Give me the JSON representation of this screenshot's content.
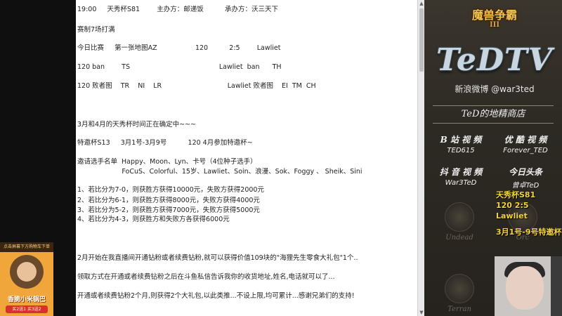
{
  "document": {
    "lines": [
      "19:00     天秀杯S81        主办方：邮递饭          承办方：沃三天下",
      "赛制7场打满",
      "今日比赛     第一张地图AZ                  120          2:5        Lawliet",
      "120 ban        TS                                          Lawliet  ban      TH",
      "120 败者图    TR    NI    LR                               Lawliet 败者图    EI  TM  CH",
      "3月和4月的天秀杯时间正在确定中~~~",
      "特邀杯S13     3月1号-3月9号          120 4月参加特邀杯~",
      "邀请选手名单  Happy、Moon、Lyn、卡号（4位种子选手）",
      "                     FoCuS、Colorful、15岁、Lawliet、Soin、浪漫、Sok、Foggy 、 Sheik、Sini",
      "1、若比分为7-0，则获胜方获得10000元，失败方获得2000元",
      "2、若比分为6-1，则获胜方获得8000元，失败方获得4000元",
      "3、若比分为5-2，则获胜方获得7000元，失败方获得5000元",
      "4、若比分为4-3，则获胜方和失败方各获得6000元",
      "2月开始在我直播间开通钻粉或者续费钻粉,就可以获得价值109块的\"海狸先生零食大礼包\"1个..",
      "领取方式在开通或者续费钻粉之后在斗鱼私信告诉我你的收货地址,姓名,电话就可以了...",
      "开通或者续费钻粉2个月,则获得2个大礼包,以此类推...不设上限,均可累计...感谢兄弟们的支持!"
    ]
  },
  "sidebar": {
    "logo_title": "魔兽争霸",
    "logo_numeral": "III",
    "brand": "TeDTV",
    "weibo": "新浪微博 @war3ted",
    "shop": "TeD的地精商店",
    "channels": [
      {
        "title": "B 站 视 频",
        "value": "TED615"
      },
      {
        "title": "优 酷 视 频",
        "value": "Forever_TED"
      },
      {
        "title": "抖 音 视 频",
        "value": "War3TeD"
      },
      {
        "title": "今日头条",
        "value": "曾卓TeD"
      }
    ],
    "races": [
      "Undead",
      "Orc",
      "Terran"
    ],
    "promo": [
      "天秀杯S81",
      "120 2:5 Lawliet",
      "3月1号-9号特邀杯"
    ]
  },
  "ad": {
    "top_text": "点击屏幕下方购物车下单",
    "product": "香脆小米锅巴",
    "offer": "买2送1 买3送2"
  },
  "colors": {
    "accent_gold": "#f4d23a",
    "doc_bg": "#ffffff",
    "sidebar_bg": "#2d2a24"
  }
}
